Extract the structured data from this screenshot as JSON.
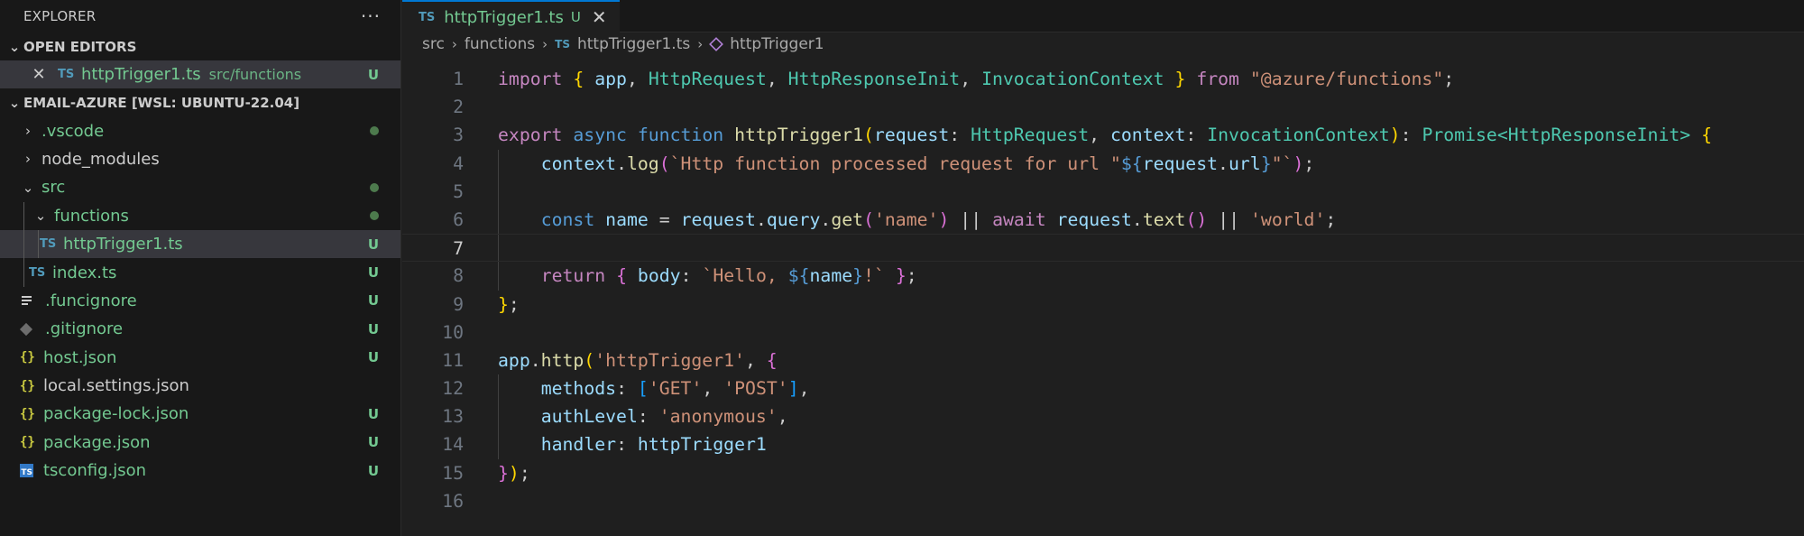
{
  "explorer": {
    "title": "EXPLORER",
    "more": "···",
    "open_editors": {
      "label": "OPEN EDITORS",
      "items": [
        {
          "icon": "TS",
          "name": "httpTrigger1.ts",
          "desc": "src/functions",
          "status": "U"
        }
      ]
    },
    "workspace": {
      "label": "EMAIL-AZURE [WSL: UBUNTU-22.04]",
      "items": [
        {
          "name": ".vscode",
          "status": "dot"
        },
        {
          "name": "node_modules",
          "status": ""
        },
        {
          "name": "src",
          "status": "dot"
        },
        {
          "name": "functions",
          "status": "dot"
        },
        {
          "icon": "TS",
          "name": "httpTrigger1.ts",
          "status": "U"
        },
        {
          "icon": "TS",
          "name": "index.ts",
          "status": "U"
        },
        {
          "name": ".funcignore",
          "status": "U"
        },
        {
          "name": ".gitignore",
          "status": "U"
        },
        {
          "icon": "{}",
          "name": "host.json",
          "status": "U"
        },
        {
          "icon": "{}",
          "name": "local.settings.json",
          "status": ""
        },
        {
          "icon": "{}",
          "name": "package-lock.json",
          "status": "U"
        },
        {
          "icon": "{}",
          "name": "package.json",
          "status": "U"
        },
        {
          "icon": "TS",
          "name": "tsconfig.json",
          "status": "U"
        }
      ]
    }
  },
  "editor": {
    "tab": {
      "icon": "TS",
      "name": "httpTrigger1.ts",
      "status": "U",
      "close": "✕"
    },
    "breadcrumb": [
      "src",
      "functions",
      "httpTrigger1.ts",
      "httpTrigger1"
    ],
    "active_line": 7,
    "lines": [
      "import { app, HttpRequest, HttpResponseInit, InvocationContext } from \"@azure/functions\";",
      "",
      "export async function httpTrigger1(request: HttpRequest, context: InvocationContext): Promise<HttpResponseInit> {",
      "    context.log(`Http function processed request for url \"${request.url}\"`);",
      "",
      "    const name = request.query.get('name') || await request.text() || 'world';",
      "",
      "    return { body: `Hello, ${name}!` };",
      "};",
      "",
      "app.http('httpTrigger1', {",
      "    methods: ['GET', 'POST'],",
      "    authLevel: 'anonymous',",
      "    handler: httpTrigger1",
      "});",
      ""
    ]
  },
  "colors": {
    "accent": "#0078d4",
    "untracked": "#73c991",
    "ts_icon": "#519aba",
    "json_icon": "#cbcb41"
  }
}
